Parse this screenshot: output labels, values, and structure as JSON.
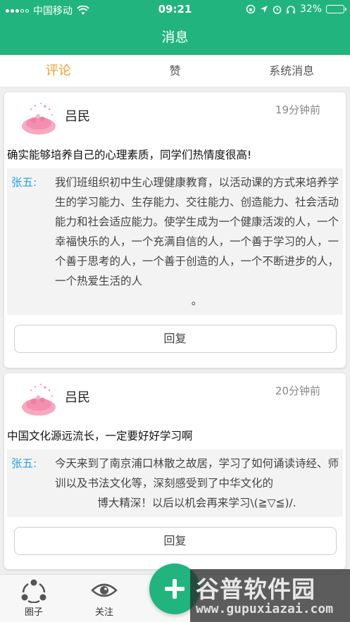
{
  "status": {
    "carrier": "中国移动",
    "time": "09:21",
    "battery": "32%",
    "battery_level": 0.32
  },
  "header": {
    "title": "消息"
  },
  "tabs": [
    {
      "label": "评论",
      "active": true
    },
    {
      "label": "赞",
      "active": false
    },
    {
      "label": "系统消息",
      "active": false
    }
  ],
  "comments": [
    {
      "user": "吕民",
      "time": "19分钟前",
      "text": "确实能够培养自己的心理素质，同学们热情度很高!",
      "reply_name": "张五:",
      "reply_text": "我们班组织初中生心理健康教育，以活动课的方式来培养学生的学习能力、生存能力、交往能力、创造能力、社会活动能力和社会适应能力。使学生成为一个健康活泼的人，一个幸福快乐的人，一个充满自信的人，一个善于学习的人，一个善于思考的人，一个善于创造的人，一个不断进步的人，一个热爱生活的人",
      "reply_end": "。",
      "reply_button": "回复"
    },
    {
      "user": "吕民",
      "time": "20分钟前",
      "text": "中国文化源远流长，一定要好好学习啊",
      "reply_name": "张五:",
      "reply_text": "今天来到了南京浦口林散之故居，学习了如何诵读诗经、师训以及书法文化等，深刻感受到了中华文化的",
      "reply_end": "博大精深！以后以机会再来学习\\(≧▽≦)/.",
      "reply_button": "回复"
    }
  ],
  "bottom_nav": {
    "circle": "圈子",
    "follow": "关注"
  },
  "watermark": {
    "title": "谷普软件园",
    "url": "www.gupuxiazai.com"
  },
  "colors": {
    "primary": "#21b47f",
    "tab_active": "#f0a030",
    "reply_name": "#2aa0e0"
  }
}
